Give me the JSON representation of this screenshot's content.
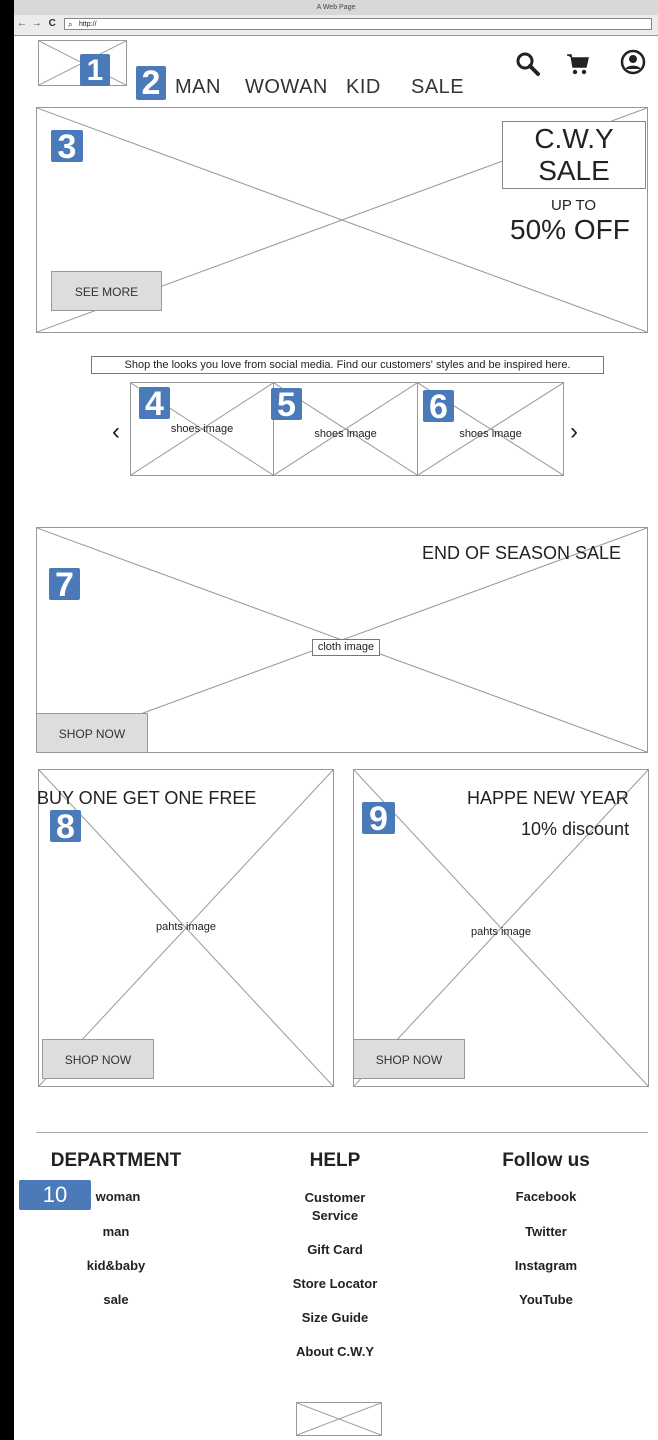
{
  "window": {
    "title": "A Web Page",
    "url": "http://"
  },
  "nav": {
    "back": "←",
    "forward": "→",
    "reload": "C"
  },
  "badges": [
    "1",
    "2",
    "3",
    "4",
    "5",
    "6",
    "7",
    "8",
    "9",
    "10"
  ],
  "header": {
    "menu": [
      "MAN",
      "WOWAN",
      "KID",
      "SALE"
    ],
    "icons": [
      "search-icon",
      "cart-icon",
      "account-icon"
    ]
  },
  "hero": {
    "brand_line1": "C.W.Y",
    "brand_line2": "SALE",
    "upto": "UP TO",
    "offer": "50% OFF",
    "button": "SEE MORE"
  },
  "social": {
    "caption": "Shop the looks you love from social media. Find our customers' styles and be inspired here.",
    "prev": "‹",
    "next": "›",
    "items": [
      "shoes image",
      "shoes image",
      "shoes image"
    ]
  },
  "season": {
    "title": "END OF SEASON SALE",
    "image_label": "cloth image",
    "button": "SHOP NOW"
  },
  "promo_left": {
    "title": "BUY ONE GET ONE FREE",
    "image_label": "pahts image",
    "button": "SHOP NOW"
  },
  "promo_right": {
    "title": "HAPPE NEW YEAR",
    "subtitle": "10% discount",
    "image_label": "pahts image",
    "button": "SHOP NOW"
  },
  "footer": {
    "department": {
      "title": "DEPARTMENT",
      "items": [
        "woman",
        "man",
        "kid&baby",
        "sale"
      ]
    },
    "help": {
      "title": "HELP",
      "items": [
        "Customer Service",
        "Gift Card",
        "Store Locator",
        "Size Guide",
        "About C.W.Y"
      ]
    },
    "follow": {
      "title": "Follow us",
      "items": [
        "Facebook",
        "Twitter",
        "Instagram",
        "YouTube"
      ]
    }
  },
  "colors": {
    "badge": "#4a7ab8",
    "button": "#dddddd",
    "border": "#999999",
    "outer": "#000000"
  }
}
